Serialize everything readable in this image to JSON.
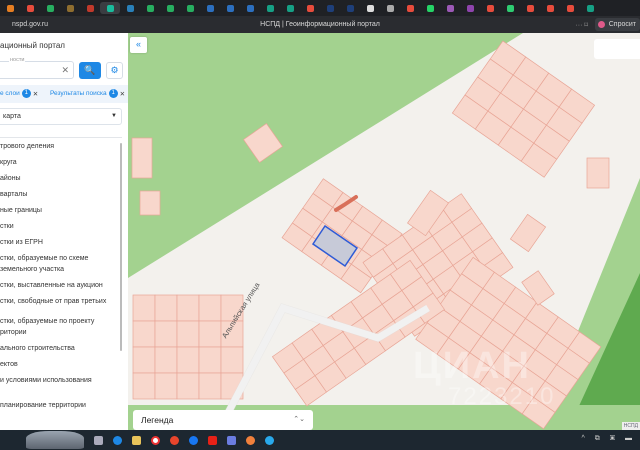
{
  "browser": {
    "url": "nspd.gov.ru",
    "title": "НСПД | Геоинформационный портал",
    "ask_button": "Спросит",
    "menu": "··· ⌑"
  },
  "tab_colors": [
    "#e67e22",
    "#e74c3c",
    "#27ae60",
    "#8e6d2f",
    "#c0392b",
    "#1abc9c",
    "#2980b9",
    "#27ae60",
    "#27ae60",
    "#27ae60",
    "#2c6fbf",
    "#2c6fbf",
    "#2c6fbf",
    "#16a085",
    "#16a085",
    "#e74c3c",
    "#1e3f7a",
    "#1e3f7a",
    "#dddddd",
    "#aaaaaa",
    "#e74c3c",
    "#25d366",
    "#9b59b6",
    "#8e44ad",
    "#e74c3c",
    "#2ecc71",
    "#e74c3c",
    "#e74c3c",
    "#e74c3c",
    "#16a085"
  ],
  "panel": {
    "title": "ационный портал",
    "search_label": "ности",
    "search_button": "🔍",
    "filter_button": "⚙",
    "chips": [
      {
        "label": "е слои",
        "count": "1"
      },
      {
        "label": "Результаты поиска",
        "count": "1"
      }
    ],
    "chip_close": "✕",
    "basemap": "карта",
    "layers": [
      "трового деления",
      "круга",
      "айоны",
      "варталы",
      "ные границы",
      "стки",
      "стки из ЕГРН",
      "стки, образуемые по схеме",
      "земельного участка",
      "стки, выставленные на аукцион",
      "стки, свободные от прав третьих",
      "стки, образуемые по проекту",
      "ритории",
      "ального строительства",
      "ектов",
      "и условиями использования",
      "планирование территории"
    ]
  },
  "map": {
    "collapse": "«",
    "legend": "Легенда",
    "legend_toggle": "⌃⌄",
    "street": "Альпийская улица",
    "watermark": [
      "ЦИАН",
      "7223210"
    ],
    "attribution": "НСПД"
  },
  "colors": {
    "accent": "#1e88e5",
    "green": "#a3d28f",
    "dark_green": "#5faa4f",
    "parcel_fill": "#f8d7cc",
    "parcel_stroke": "#e8a596",
    "selected": "#c7cad8",
    "selected_stroke": "#2f5bd6"
  },
  "taskbar": {
    "tray": "^ ⧉ ▣ ▬"
  }
}
